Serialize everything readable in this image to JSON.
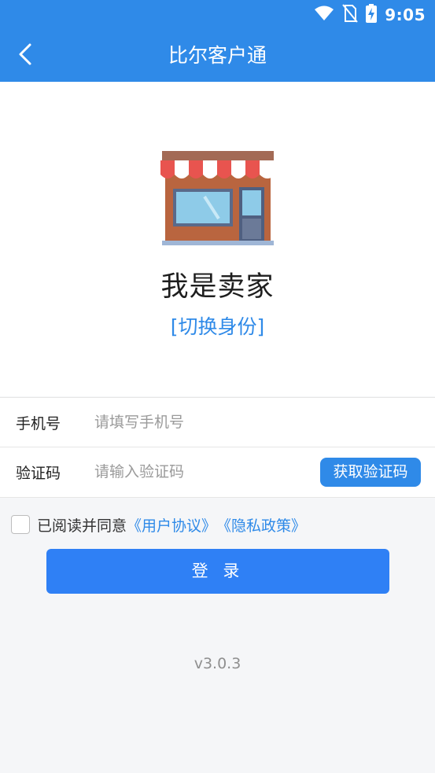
{
  "status_bar": {
    "time": "9:05",
    "icons": [
      "wifi-icon",
      "no-sim-icon",
      "battery-charging-icon"
    ]
  },
  "header": {
    "title": "比尔客户通",
    "back_icon": "chevron-left-icon"
  },
  "hero": {
    "illustration": "shop-storefront-icon",
    "role_title": "我是卖家",
    "switch_link": "[切换身份]"
  },
  "form": {
    "phone": {
      "label": "手机号",
      "placeholder": "请填写手机号",
      "value": ""
    },
    "code": {
      "label": "验证码",
      "placeholder": "请输入验证码",
      "value": "",
      "button_label": "获取验证码"
    }
  },
  "agreement": {
    "checked": false,
    "text": "已阅读并同意",
    "user_agreement_link": "《用户协议》",
    "privacy_link": "《隐私政策》"
  },
  "login_button": {
    "label": "登 录"
  },
  "version": "v3.0.3",
  "colors": {
    "primary": "#2f8ae8",
    "button": "#2f80f5",
    "background": "#f5f6f8",
    "text": "#222222",
    "placeholder": "#9a9a9a"
  }
}
